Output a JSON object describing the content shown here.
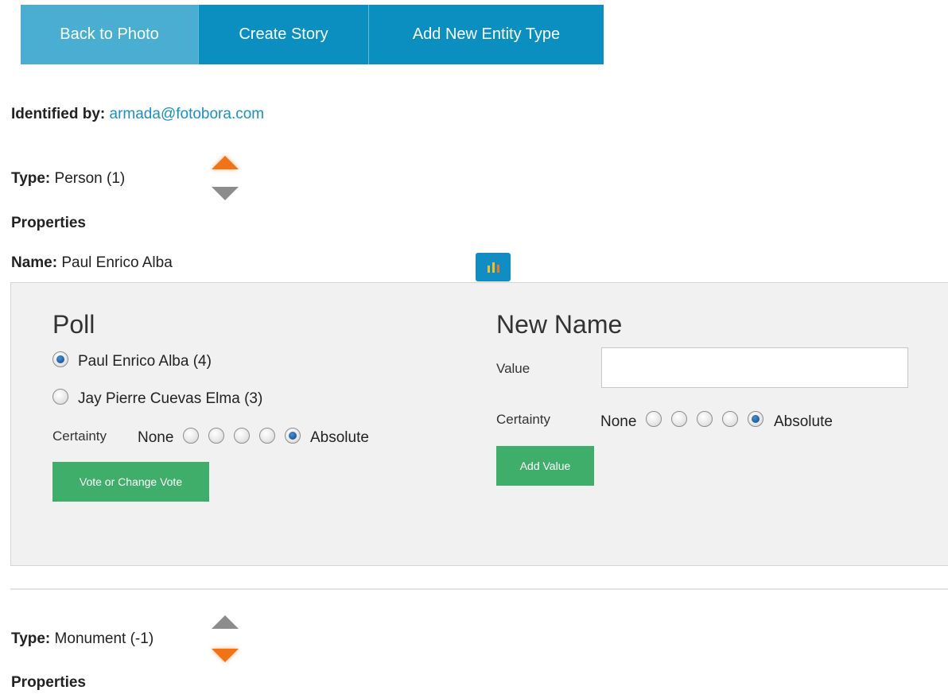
{
  "nav": {
    "back": "Back to Photo",
    "story": "Create Story",
    "entity": "Add New Entity Type"
  },
  "identified": {
    "label": "Identified by:",
    "email": "armada@fotobora.com"
  },
  "entities": [
    {
      "type_label": "Type:",
      "type_value": "Person (1)",
      "properties_label": "Properties",
      "name_label": "Name:",
      "name_value": "Paul Enrico Alba"
    },
    {
      "type_label": "Type:",
      "type_value": "Monument (-1)",
      "properties_label": "Properties"
    }
  ],
  "poll": {
    "title": "Poll",
    "options": [
      {
        "label": "Paul Enrico Alba (4)",
        "checked": true
      },
      {
        "label": "Jay Pierre Cuevas Elma (3)",
        "checked": false
      }
    ],
    "certainty_label": "Certainty",
    "none_label": "None",
    "absolute_label": "Absolute",
    "certainty_levels": 5,
    "certainty_selected": 5,
    "vote_button": "Vote or Change Vote"
  },
  "new_name": {
    "title": "New Name",
    "value_label": "Value",
    "value": "",
    "certainty_label": "Certainty",
    "none_label": "None",
    "absolute_label": "Absolute",
    "certainty_levels": 5,
    "certainty_selected": 5,
    "add_button": "Add Value"
  },
  "colors": {
    "nav_light": "#4aaed2",
    "nav_dark": "#0b8fc0",
    "vote_up": "#f27216",
    "vote_neutral": "#8c8c8c",
    "button_green": "#3fae6a",
    "poll_icon_bg": "#128dc3"
  },
  "icons": {
    "poll": "bar-chart-icon",
    "upvote": "arrow-up-icon",
    "downvote": "arrow-down-icon"
  }
}
